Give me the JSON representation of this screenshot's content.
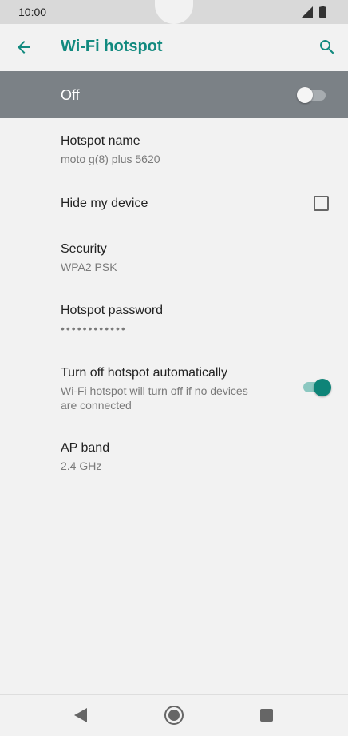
{
  "status_bar": {
    "time": "10:00",
    "icons": [
      "signal-icon",
      "battery-icon"
    ]
  },
  "app_bar": {
    "title": "Wi-Fi hotspot",
    "back_icon": "arrow-left",
    "search_icon": "magnifier",
    "accent_color": "#128a7f"
  },
  "master_switch": {
    "label": "Off",
    "state": "off",
    "background": "#7b8186"
  },
  "settings": {
    "hotspot_name": {
      "title": "Hotspot name",
      "value": "moto g(8) plus 5620"
    },
    "hide_device": {
      "title": "Hide my device",
      "checked": false
    },
    "security": {
      "title": "Security",
      "value": "WPA2 PSK"
    },
    "password": {
      "title": "Hotspot password",
      "value": "••••••••••••"
    },
    "auto_off": {
      "title": "Turn off hotspot automatically",
      "description_line1": "Wi-Fi hotspot will turn off if no devices",
      "description_line2": "are connected",
      "enabled": true,
      "toggle_color": "#0e8478"
    },
    "ap_band": {
      "title": "AP band",
      "value": "2.4 GHz"
    }
  },
  "nav_bar": {
    "buttons": [
      "back-triangle",
      "home-circle",
      "recents-square"
    ]
  }
}
